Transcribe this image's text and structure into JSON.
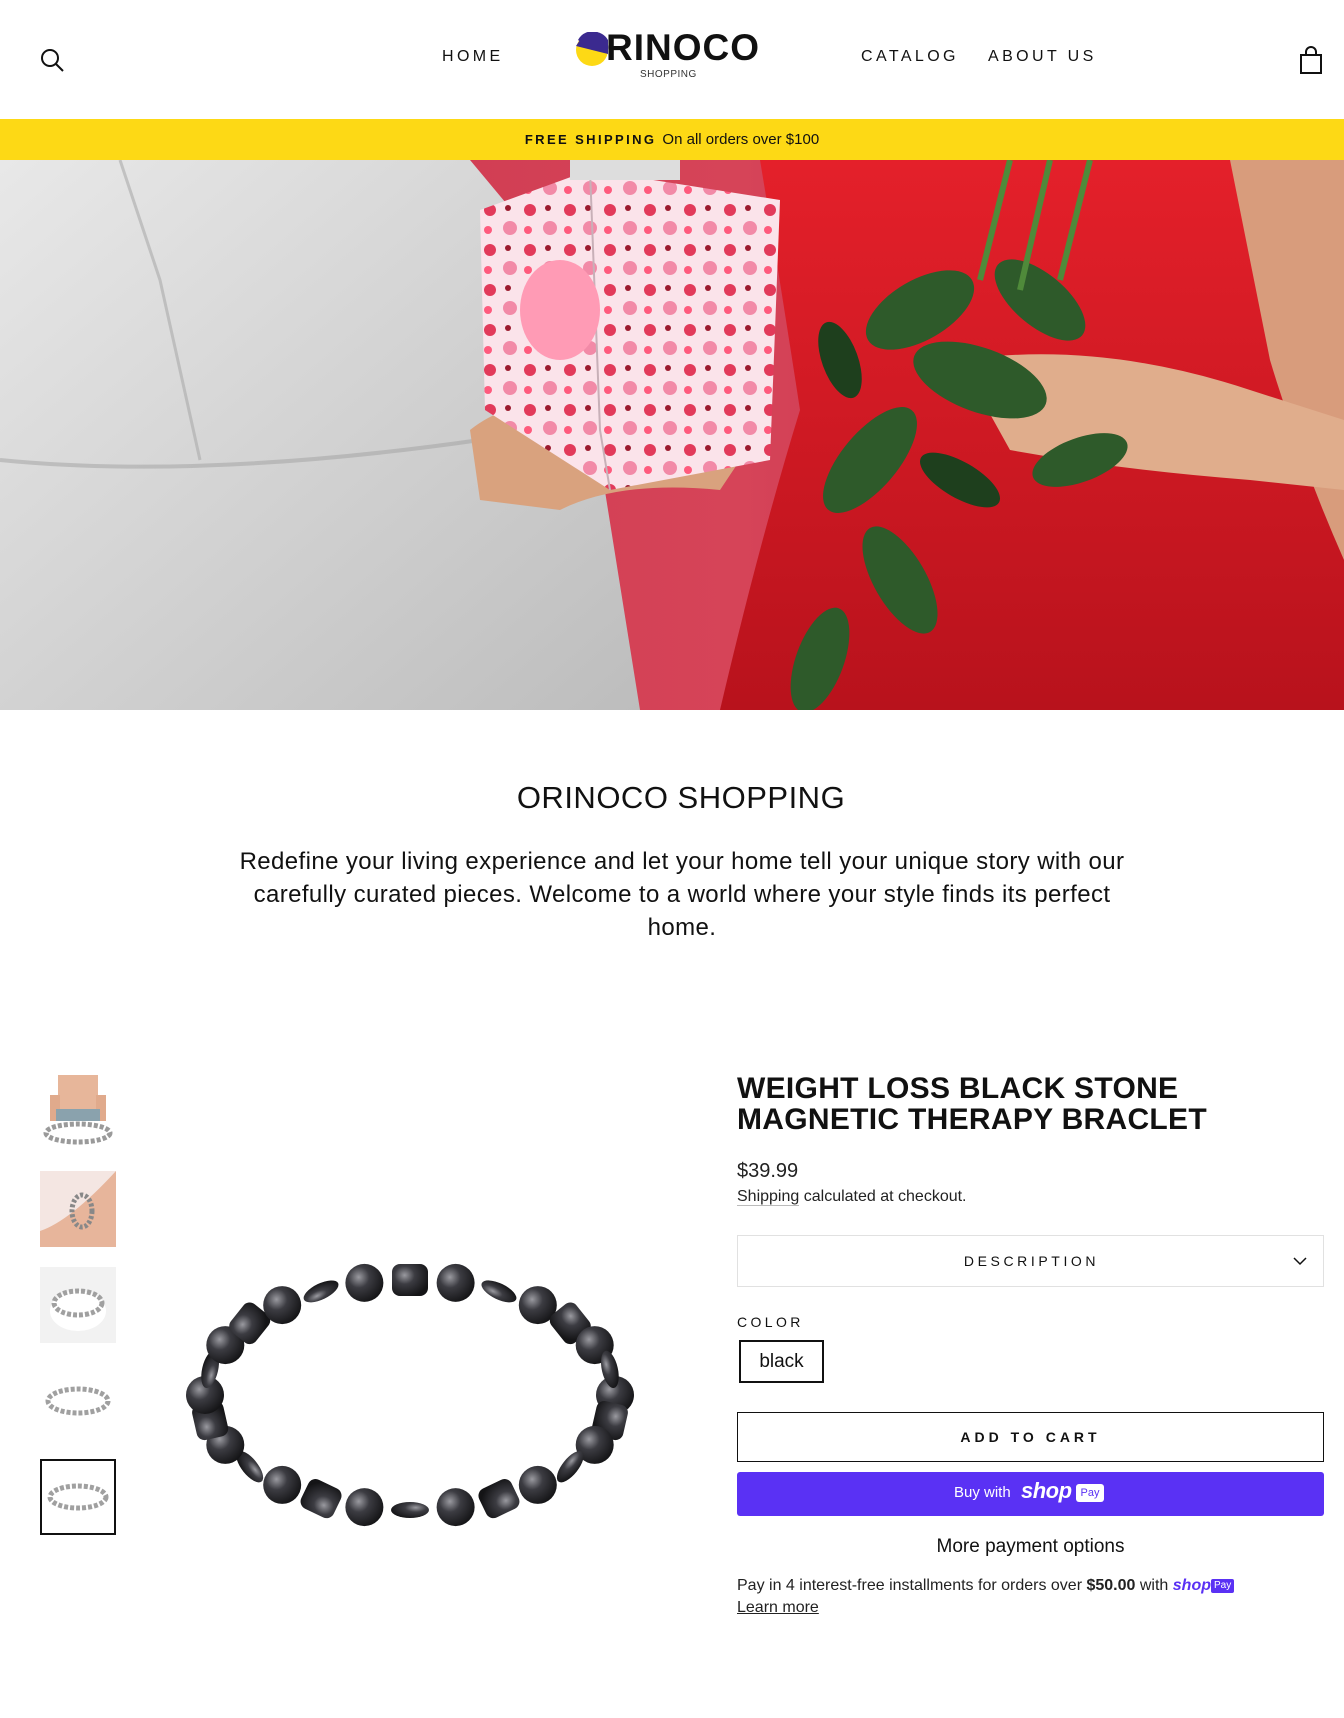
{
  "header": {
    "nav_left": [
      "HOME"
    ],
    "nav_right": [
      "CATALOG",
      "ABOUT US"
    ],
    "logo_text": "RINOCO",
    "logo_sub": "SHOPPING"
  },
  "announcement": {
    "strong": "FREE SHIPPING",
    "text": "On all orders over $100"
  },
  "intro": {
    "title": "ORINOCO SHOPPING",
    "text": "Redefine your living experience and let your home tell your unique story with our carefully curated pieces. Welcome to a world where your style finds its perfect home."
  },
  "product": {
    "title": "Weight Loss Black Stone Magnetic Therapy Braclet",
    "price": "$39.99",
    "shipping_link": "Shipping",
    "shipping_rest": "calculated at checkout.",
    "description_label": "DESCRIPTION",
    "color_label": "COLOR",
    "color_value": "black",
    "add_to_cart": "ADD TO CART",
    "buy_with": "Buy with",
    "shop_word": "shop",
    "pay_badge": "Pay",
    "more_payment": "More payment options",
    "installments_pre": "Pay in 4 interest-free installments for orders over",
    "installments_amount": "$50.00",
    "installments_with": "with",
    "learn_more": "Learn more"
  },
  "colors": {
    "accent_yellow": "#fdd915",
    "shop_pay_purple": "#5a31f4",
    "logo_purple": "#3b2a8f"
  }
}
